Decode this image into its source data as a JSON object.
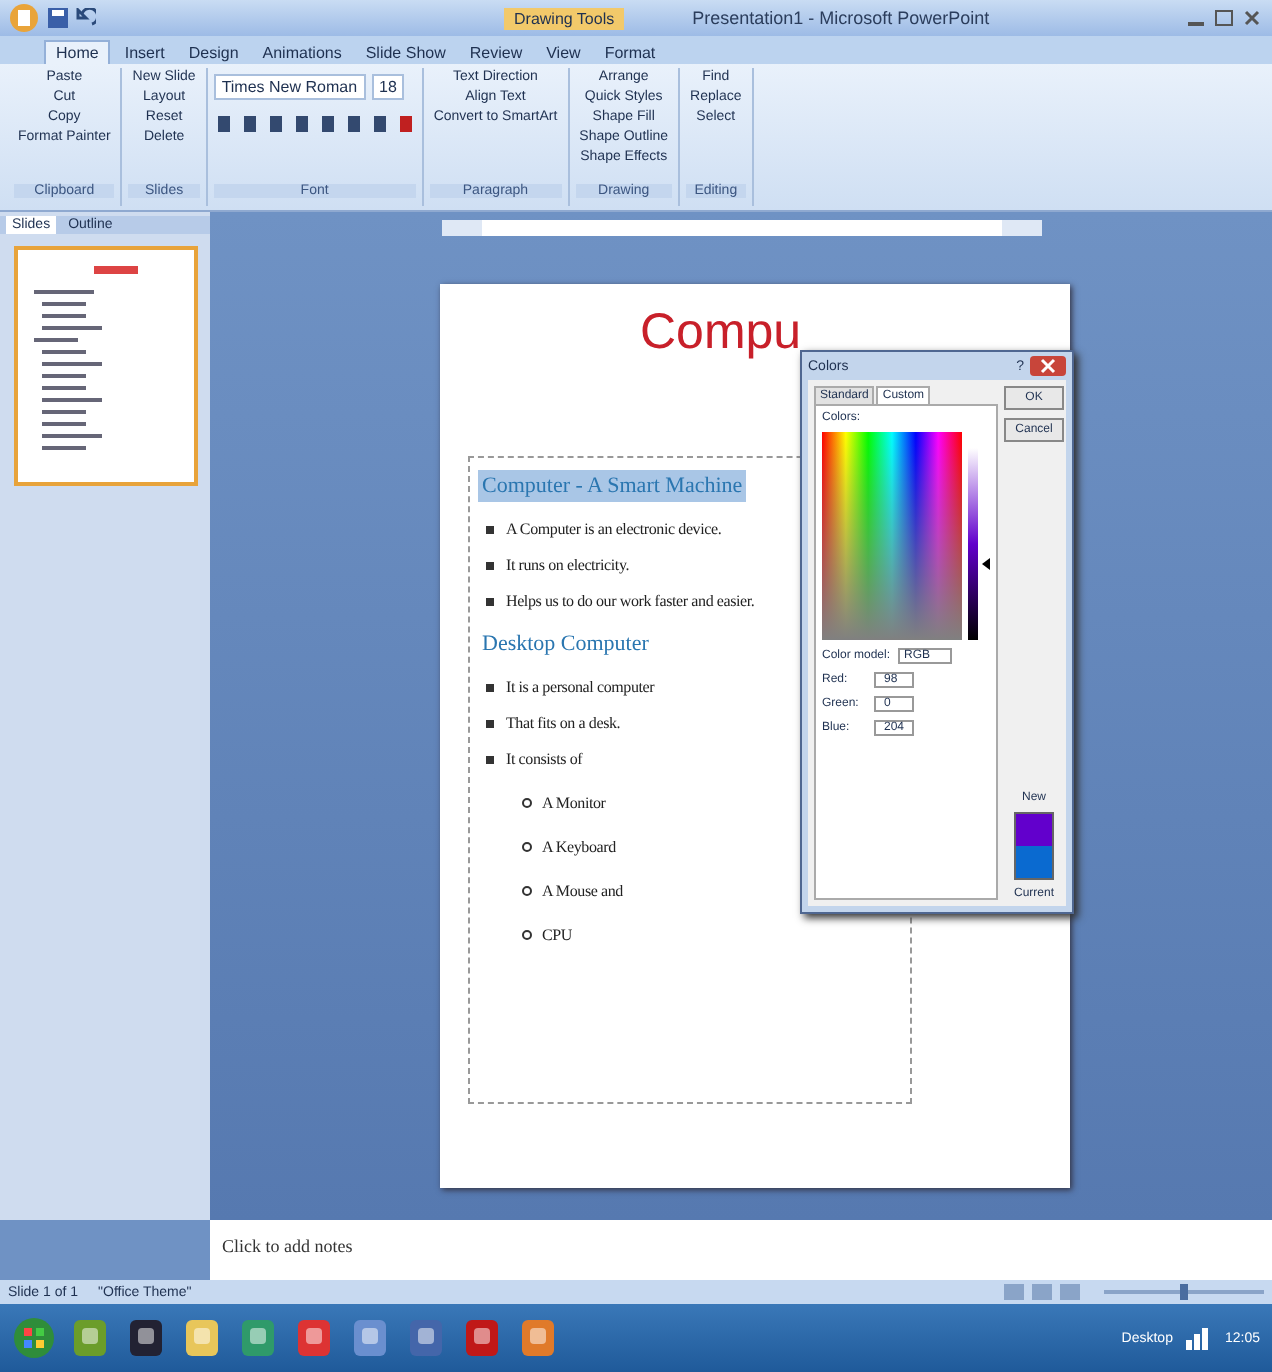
{
  "window": {
    "title": "Presentation1 - Microsoft PowerPoint",
    "context_tab": "Drawing Tools"
  },
  "ribbon": {
    "tabs": [
      {
        "label": "Home",
        "selected": true
      },
      {
        "label": "Insert",
        "selected": false
      },
      {
        "label": "Design",
        "selected": false
      },
      {
        "label": "Animations",
        "selected": false
      },
      {
        "label": "Slide Show",
        "selected": false
      },
      {
        "label": "Review",
        "selected": false
      },
      {
        "label": "View",
        "selected": false
      },
      {
        "label": "Format",
        "selected": false
      }
    ],
    "groups": [
      {
        "label": "Clipboard",
        "buttons": [
          "Paste",
          "Cut",
          "Copy",
          "Format Painter"
        ]
      },
      {
        "label": "Slides",
        "buttons": [
          "New Slide",
          "Layout",
          "Reset",
          "Delete"
        ]
      },
      {
        "label": "Font",
        "font": "Times New Roman",
        "size": "18"
      },
      {
        "label": "Paragraph",
        "buttons": [
          "Text Direction",
          "Align Text",
          "Convert to SmartArt"
        ]
      },
      {
        "label": "Drawing",
        "buttons": [
          "Arrange",
          "Quick Styles",
          "Shape Fill",
          "Shape Outline",
          "Shape Effects"
        ]
      },
      {
        "label": "Editing",
        "buttons": [
          "Find",
          "Replace",
          "Select"
        ]
      }
    ]
  },
  "slides_pane": {
    "tabs": [
      {
        "label": "Slides",
        "selected": true
      },
      {
        "label": "Outline",
        "selected": false
      }
    ]
  },
  "slide": {
    "title": "Compu",
    "sections": [
      {
        "heading": "Computer - A Smart Machine",
        "highlighted": true,
        "bullets": [
          {
            "text": "A Computer is an electronic device."
          },
          {
            "text": "It runs on electricity."
          },
          {
            "text": "Helps us to do our work faster and easier."
          }
        ]
      },
      {
        "heading": "Desktop Computer",
        "highlighted": false,
        "bullets": [
          {
            "text": "It is a personal computer"
          },
          {
            "text": "That fits on a desk."
          },
          {
            "text": "It consists of",
            "children": [
              {
                "text": "A Monitor"
              },
              {
                "text": "A Keyboard"
              },
              {
                "text": "A Mouse and"
              },
              {
                "text": "CPU"
              }
            ]
          }
        ]
      }
    ]
  },
  "dialog": {
    "title": "Colors",
    "tabs": [
      {
        "label": "Standard",
        "selected": false
      },
      {
        "label": "Custom",
        "selected": true
      }
    ],
    "colors_label": "Colors:",
    "model_label": "Color model:",
    "model": "RGB",
    "fields": [
      {
        "label": "Red:",
        "value": "98"
      },
      {
        "label": "Green:",
        "value": "0"
      },
      {
        "label": "Blue:",
        "value": "204"
      }
    ],
    "help": "?",
    "buttons": [
      "OK",
      "Cancel"
    ],
    "new_label": "New",
    "current_label": "Current"
  },
  "notes": {
    "placeholder": "Click to add notes"
  },
  "status_bar": [
    "Slide 1 of 1",
    "\"Office Theme\""
  ],
  "zoom": {
    "level": 0.5
  },
  "taskbar": {
    "tray_label": "Desktop",
    "clock": "12:05"
  }
}
